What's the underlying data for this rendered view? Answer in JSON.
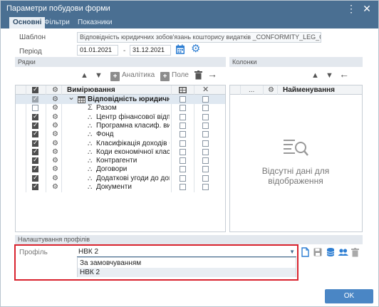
{
  "window": {
    "title": "Параметри побудови форми"
  },
  "tabs": [
    {
      "label": "Основні"
    },
    {
      "label": "Фільтри"
    },
    {
      "label": "Показники"
    }
  ],
  "form": {
    "template_label": "Шаблон",
    "template_value": "Відповідність юридичних зобов'язань кошторису видатків _CONFORMITY_LEG_OBL_BUDGET",
    "period_label": "Період",
    "date_from": "01.01.2021",
    "date_sep": "-",
    "date_to": "31.12.2021"
  },
  "rows_section": {
    "title": "Рядки",
    "btn_analytics": "Аналітика",
    "btn_field": "Поле",
    "col_dimensions": "Вимірювання",
    "rows": [
      {
        "text": "Відповідність юридичних зо",
        "checked": true,
        "bold": true,
        "icon": "table-icon"
      },
      {
        "text": "Разом",
        "checked": false,
        "icon": "sigma-icon"
      },
      {
        "text": "Центр фінансової відпові",
        "checked": true,
        "icon": "hierarchy-icon"
      },
      {
        "text": "Програмна класиф. видат",
        "checked": true,
        "icon": "hierarchy-icon"
      },
      {
        "text": "Фонд",
        "checked": true,
        "icon": "hierarchy-icon"
      },
      {
        "text": "Класифікація доходів бюд",
        "checked": true,
        "icon": "hierarchy-icon"
      },
      {
        "text": "Коди економічної класиф",
        "checked": true,
        "icon": "hierarchy-icon"
      },
      {
        "text": "Контрагенти",
        "checked": true,
        "icon": "hierarchy-icon"
      },
      {
        "text": "Договори",
        "checked": true,
        "icon": "hierarchy-icon"
      },
      {
        "text": "Додаткові угоди до догов",
        "checked": true,
        "icon": "hierarchy-icon"
      },
      {
        "text": "Документи",
        "checked": true,
        "icon": "hierarchy-icon"
      }
    ]
  },
  "columns_section": {
    "title": "Колонки",
    "col_name": "Найменування",
    "col_dots": "...",
    "empty_line1": "Відсутні дані для",
    "empty_line2": "відображення"
  },
  "profile": {
    "section_title": "Налаштування профілів",
    "label": "Профіль",
    "selected": "НВК 2",
    "options": [
      "За замовчуванням",
      "НВК 2"
    ]
  },
  "ok_button": "OK",
  "colors": {
    "titlebar": "#4a6f92",
    "accent": "#4a86c5",
    "highlight": "#d9232e"
  }
}
